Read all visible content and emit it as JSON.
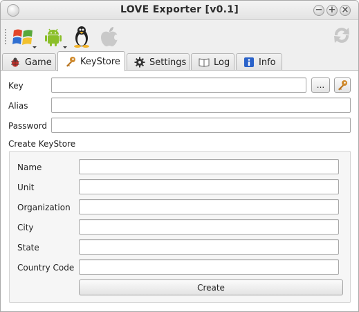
{
  "window": {
    "title": "LOVE Exporter [v0.1]"
  },
  "toolbar": {
    "icons": [
      "windows-icon",
      "android-icon",
      "linux-icon",
      "apple-icon",
      "refresh-icon"
    ]
  },
  "tabs": [
    {
      "label": "Game",
      "icon": "bug-icon"
    },
    {
      "label": "KeyStore",
      "icon": "key-icon",
      "active": true
    },
    {
      "label": "Settings",
      "icon": "gear-icon"
    },
    {
      "label": "Log",
      "icon": "log-icon"
    },
    {
      "label": "Info",
      "icon": "info-icon"
    }
  ],
  "keystore": {
    "key_label": "Key",
    "key_value": "",
    "browse_label": "...",
    "alias_label": "Alias",
    "alias_value": "",
    "password_label": "Password",
    "password_value": "",
    "create_group_title": "Create KeyStore",
    "name_label": "Name",
    "unit_label": "Unit",
    "organization_label": "Organization",
    "city_label": "City",
    "state_label": "State",
    "country_label": "Country Code",
    "create_label": "Create"
  }
}
